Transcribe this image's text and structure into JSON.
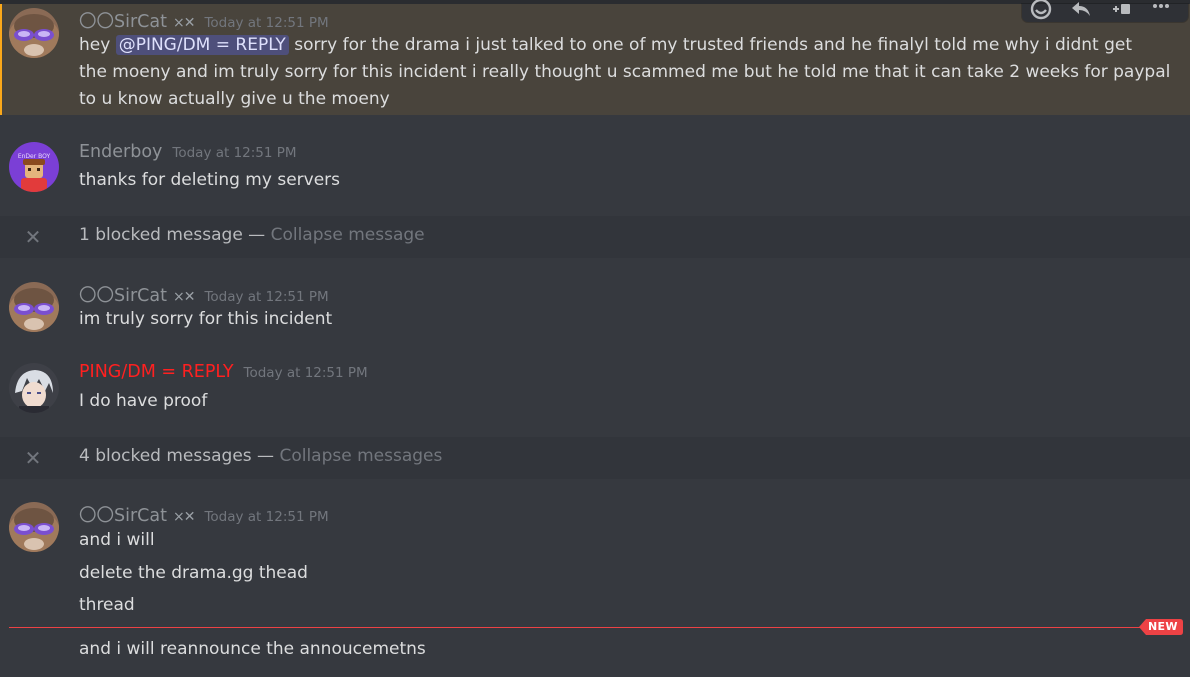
{
  "messages": [
    {
      "username": "〇〇SirCat",
      "tag": "×✕",
      "timestamp": "Today at 12:51 PM",
      "mention": "@PING/DM = REPLY",
      "line1_rest": "sorry for the drama i just talked to one of my trusted friends and he finalyl told me why i didnt get",
      "line2": "the moeny and im truly sorry for this incident i really thought u scammed me but he told me that it can take 2 weeks for paypal",
      "line3": "to u know actually give u the moeny"
    },
    {
      "username": "Enderboy",
      "timestamp": "Today at 12:51 PM",
      "avatar_text": "EnDer BOY",
      "line1": "thanks for deleting my servers"
    },
    {
      "username": "〇〇SirCat",
      "tag": "×✕",
      "timestamp": "Today at 12:51 PM",
      "line1": "im truly sorry for this incident"
    },
    {
      "username": "PING/DM = REPLY",
      "timestamp": "Today at 12:51 PM",
      "line1": "I do have proof"
    },
    {
      "username": "〇〇SirCat",
      "tag": "×✕",
      "timestamp": "Today at 12:51 PM",
      "line1": "and i will",
      "line2": "delete the drama.gg thead",
      "line3": "thread",
      "line4": "and i will reannounce the annoucemetns"
    }
  ],
  "blocked": [
    {
      "text": "1 blocked message",
      "sep": " — ",
      "action": "Collapse message"
    },
    {
      "text": "4 blocked messages",
      "sep": " — ",
      "action": "Collapse messages"
    }
  ],
  "new_divider": {
    "label": "NEW",
    "color": "#ed4245"
  },
  "toolbar_icons": [
    "add-reaction-icon",
    "reply-icon",
    "create-thread-icon",
    "more-icon"
  ],
  "colors": {
    "background": "#36393f",
    "mention_highlight": "#49443c",
    "mention_bar": "#faa81a",
    "red_username": "#ff2020"
  }
}
